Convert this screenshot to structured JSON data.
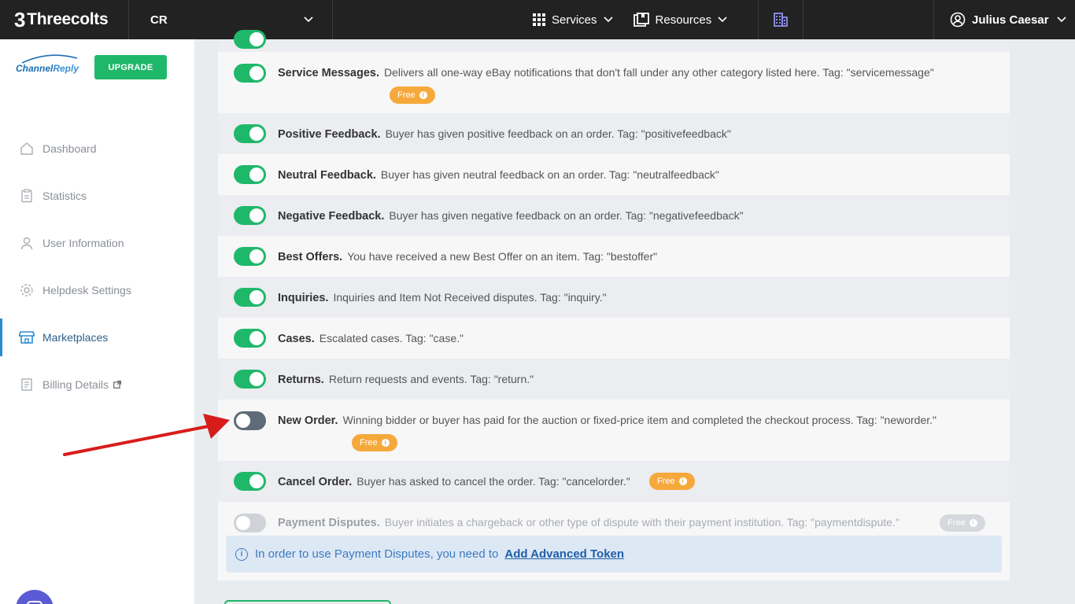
{
  "topbar": {
    "brand": "Threecolts",
    "account": "CR",
    "nav": [
      {
        "label": "Services",
        "icon": "grid-icon"
      },
      {
        "label": "Resources",
        "icon": "book-icon"
      }
    ],
    "user": "Julius Caesar"
  },
  "sidebar": {
    "logo_text_a": "Channel",
    "logo_text_b": "Reply",
    "upgrade_label": "UPGRADE",
    "items": [
      {
        "label": "Dashboard",
        "icon": "home-icon"
      },
      {
        "label": "Statistics",
        "icon": "clipboard-icon"
      },
      {
        "label": "User Information",
        "icon": "user-icon"
      },
      {
        "label": "Helpdesk Settings",
        "icon": "gear-icon"
      },
      {
        "label": "Marketplaces",
        "icon": "store-icon",
        "active": true
      },
      {
        "label": "Billing Details",
        "icon": "receipt-icon",
        "external": true
      }
    ]
  },
  "notifications": [
    {
      "title": "Service Messages.",
      "desc": "Delivers all one-way eBay notifications that don't fall under any other category listed here. Tag: \"servicemessage\"",
      "state": "on",
      "badge": "Free"
    },
    {
      "title": "Positive Feedback.",
      "desc": "Buyer has given positive feedback on an order. Tag: \"positivefeedback\"",
      "state": "on"
    },
    {
      "title": "Neutral Feedback.",
      "desc": "Buyer has given neutral feedback on an order. Tag: \"neutralfeedback\"",
      "state": "on"
    },
    {
      "title": "Negative Feedback.",
      "desc": "Buyer has given negative feedback on an order. Tag: \"negativefeedback\"",
      "state": "on"
    },
    {
      "title": "Best Offers.",
      "desc": "You have received a new Best Offer on an item. Tag: \"bestoffer\"",
      "state": "on"
    },
    {
      "title": "Inquiries.",
      "desc": "Inquiries and Item Not Received disputes. Tag: \"inquiry.\"",
      "state": "on"
    },
    {
      "title": "Cases.",
      "desc": "Escalated cases. Tag: \"case.\"",
      "state": "on"
    },
    {
      "title": "Returns.",
      "desc": "Return requests and events. Tag: \"return.\"",
      "state": "on"
    },
    {
      "title": "New Order.",
      "desc": "Winning bidder or buyer has paid for the auction or fixed-price item and completed the checkout process. Tag: \"neworder.\"",
      "state": "off",
      "badge": "Free"
    },
    {
      "title": "Cancel Order.",
      "desc": "Buyer has asked to cancel the order. Tag: \"cancelorder.\"",
      "state": "on",
      "badge": "Free"
    },
    {
      "title": "Payment Disputes.",
      "desc": "Buyer initiates a chargeback or other type of dispute with their payment institution. Tag: \"paymentdispute.\"",
      "state": "disabled",
      "badge": "Free"
    }
  ],
  "notice": {
    "text": "In order to use Payment Disputes, you need to",
    "link": "Add Advanced Token"
  },
  "colors": {
    "accent": "#1fb86a",
    "badge": "#f6a93b",
    "link": "#1f5ea8"
  }
}
